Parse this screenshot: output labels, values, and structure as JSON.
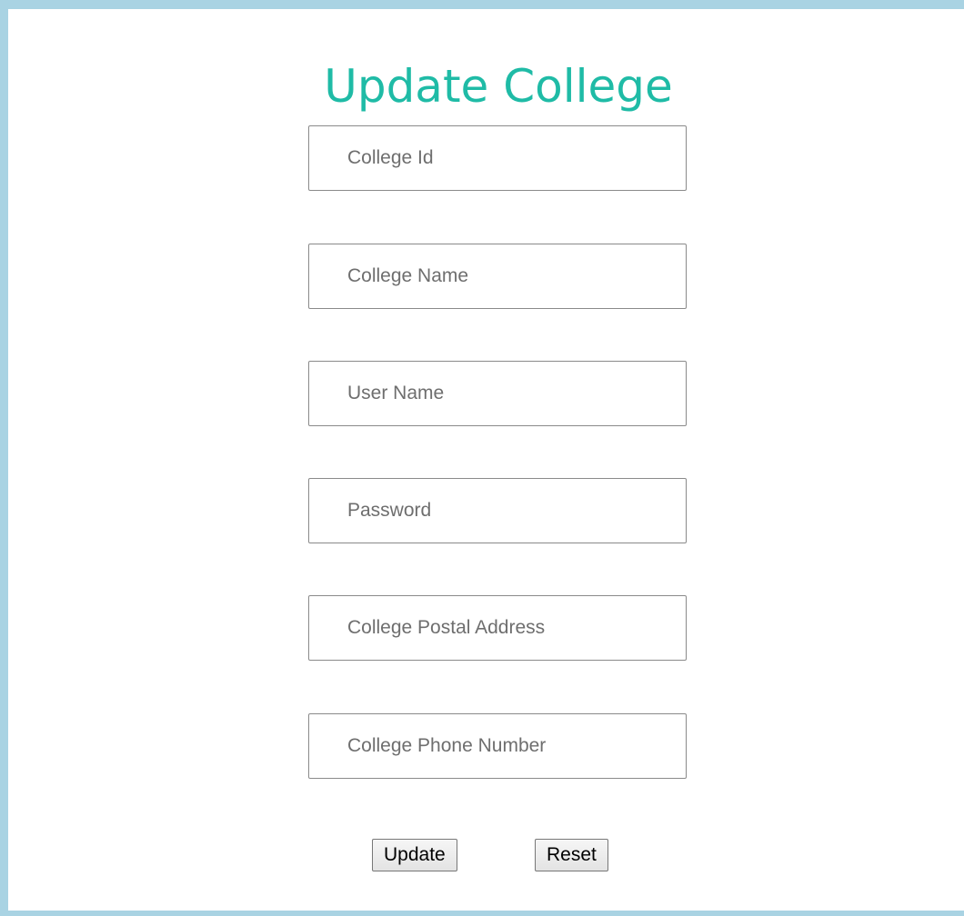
{
  "form": {
    "title": "Update College",
    "fields": [
      {
        "placeholder": "College Id",
        "value": ""
      },
      {
        "placeholder": "College Name",
        "value": ""
      },
      {
        "placeholder": "User Name",
        "value": ""
      },
      {
        "placeholder": "Password",
        "value": ""
      },
      {
        "placeholder": "College Postal Address",
        "value": ""
      },
      {
        "placeholder": "College Phone Number",
        "value": ""
      }
    ],
    "update_label": "Update",
    "reset_label": "Reset"
  },
  "colors": {
    "frame_border": "#a9d3e3",
    "title": "#1fbba6",
    "background": "#ffffff"
  }
}
